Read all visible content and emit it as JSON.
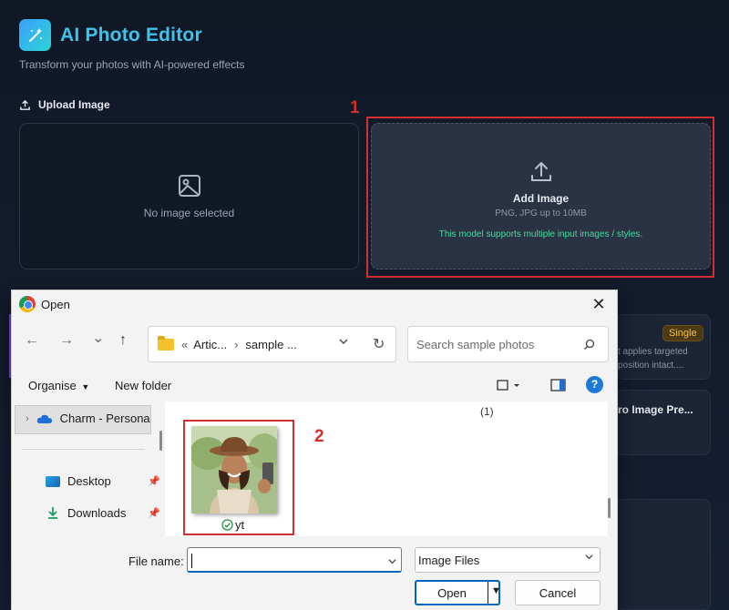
{
  "app": {
    "title": "AI Photo Editor",
    "subtitle": "Transform your photos with AI-powered effects",
    "upload_heading": "Upload Image",
    "preview_empty": "No image selected",
    "dropzone": {
      "label": "Add Image",
      "hint": "PNG, JPG up to 10MB",
      "support": "This model supports multiple input images / styles."
    },
    "cards": {
      "badge": "Single",
      "desc_line1": "t applies targeted",
      "desc_line2": "position intact....",
      "title2": "ro Image Pre..."
    }
  },
  "annotations": {
    "step1": "1",
    "step2": "2"
  },
  "colors": {
    "accent_red": "#d32f2f",
    "title_cyan": "#3fc3ea",
    "support_green": "#4ad9a1",
    "dialog_blue": "#0067c0"
  },
  "dialog": {
    "title": "Open",
    "close": "✕",
    "nav": {
      "back": "←",
      "forward": "→",
      "recent": "⌄",
      "up": "↑"
    },
    "address": {
      "prefix": "«",
      "part1": "Artic...",
      "sep": "›",
      "part2": "sample ..."
    },
    "refresh": "↻",
    "search_placeholder": "Search sample photos",
    "toolbar": {
      "organise": "Organise",
      "new_folder": "New folder"
    },
    "sidebar": [
      {
        "label": "Charm - Persona",
        "icon": "cloud-icon"
      },
      {
        "label": "Desktop",
        "icon": "desktop-icon"
      },
      {
        "label": "Downloads",
        "icon": "download-icon"
      }
    ],
    "group_count": "(1)",
    "file": {
      "name": "yt",
      "sync_status": "synced-check-icon"
    },
    "filename_label": "File name:",
    "filename_value": "",
    "filter": "Image Files",
    "open_button": "Open",
    "cancel_button": "Cancel"
  }
}
